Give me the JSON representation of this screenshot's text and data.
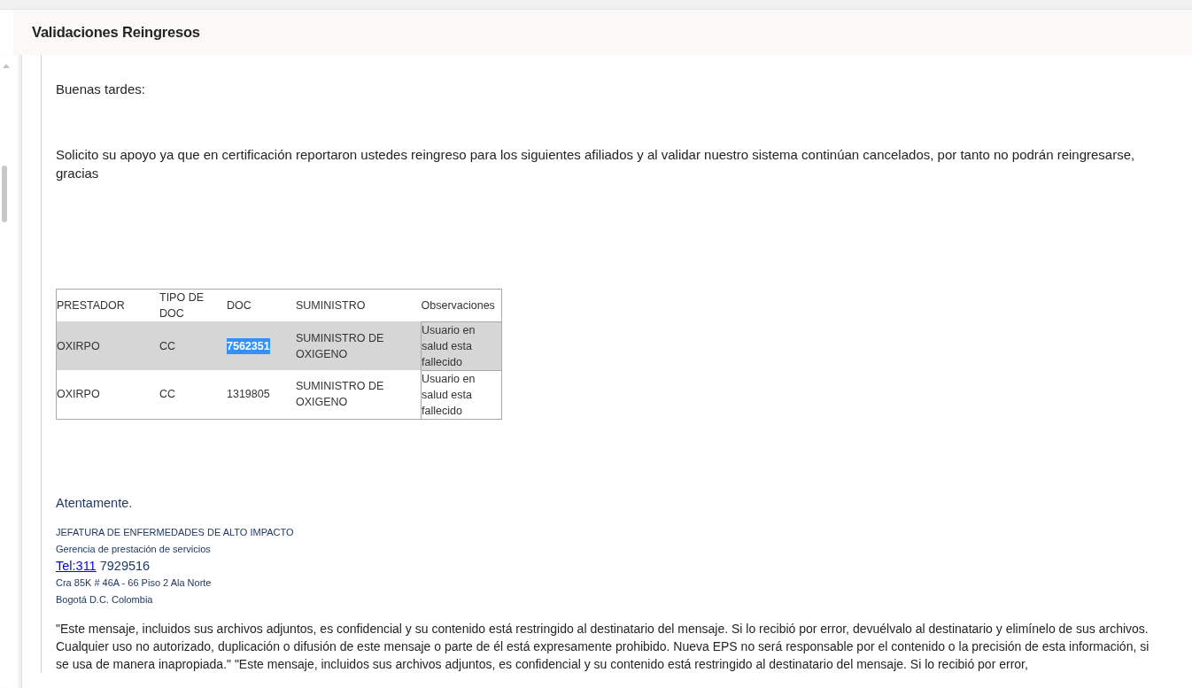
{
  "header": {
    "title": "Validaciones Reingresos"
  },
  "message": {
    "greeting": "Buenas tardes:",
    "body": "Solicito su apoyo ya que en certificación reportaron ustedes reingreso para los siguientes afiliados y al validar nuestro sistema continúan cancelados, por tanto no podrán reingresarse, gracias",
    "table": {
      "columns": [
        "PRESTADOR",
        "TIPO DE DOC",
        "DOC",
        "SUMINISTRO",
        "Observaciones"
      ],
      "rows": [
        {
          "selected": true,
          "cells": [
            {
              "text": "OXIRPO",
              "highlighted": false
            },
            {
              "text": "CC",
              "highlighted": false
            },
            {
              "text": "7562351",
              "highlighted": true
            },
            {
              "text": "SUMINISTRO DE OXIGENO",
              "highlighted": false
            },
            {
              "text": "Usuario en salud esta fallecido",
              "highlighted": false
            }
          ]
        },
        {
          "selected": false,
          "cells": [
            {
              "text": "OXIRPO",
              "highlighted": false
            },
            {
              "text": "CC",
              "highlighted": false
            },
            {
              "text": "1319805",
              "highlighted": false
            },
            {
              "text": "SUMINISTRO DE OXIGENO",
              "highlighted": false
            },
            {
              "text": "Usuario en salud esta fallecido",
              "highlighted": false
            }
          ]
        }
      ]
    },
    "closing": "Atentamente.",
    "signature": {
      "department": "JEFATURA DE ENFERMEDADES DE ALTO IMPACTO",
      "office": "Gerencia de prestación de servicios",
      "phone_link": "Tel:311",
      "phone_rest": "7929516",
      "address": "Cra 85K # 46A - 66 Piso 2 Ala Norte",
      "city": "Bogotá D.C. Colombia"
    },
    "disclaimer": "\"Este mensaje, incluidos sus archivos adjuntos, es confidencial y su contenido está restringido al destinatario del mensaje. Si lo recibió por error, devuélvalo al destinatario y elimínelo de sus archivos. Cualquier uso no autorizado, duplicación o difusión de este mensaje o parte de él está expresamente prohibido. Nueva EPS no será responsable por el contenido o la precisión de esta información, si se usa de manera inapropiada.\" \"Este mensaje, incluidos sus archivos adjuntos, es confidencial y su contenido está restringido al destinatario del mensaje. Si lo recibió por error,"
  }
}
